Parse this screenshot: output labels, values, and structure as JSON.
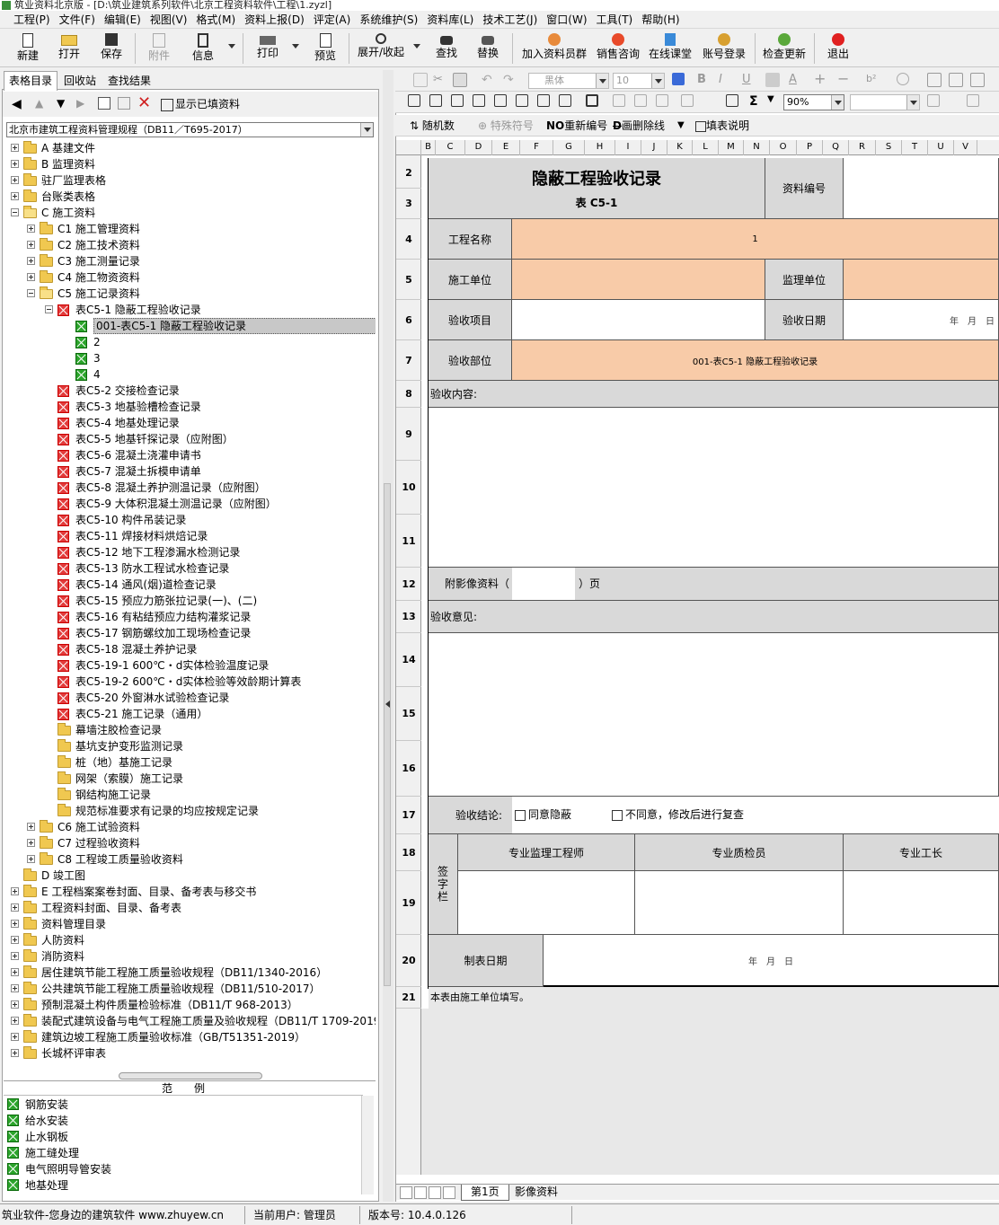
{
  "window": {
    "title": "筑业资料北京版 - [D:\\筑业建筑系列软件\\北京工程资料软件\\工程\\1.zyzl]"
  },
  "menu": [
    "工程(P)",
    "文件(F)",
    "编辑(E)",
    "视图(V)",
    "格式(M)",
    "资料上报(D)",
    "评定(A)",
    "系统维护(S)",
    "资料库(L)",
    "技术工艺(J)",
    "窗口(W)",
    "工具(T)",
    "帮助(H)"
  ],
  "toolbar": {
    "new": "新建",
    "open": "打开",
    "save": "保存",
    "attach": "附件",
    "info": "信息",
    "print": "打印",
    "preview": "预览",
    "expand": "展开/收起",
    "find": "查找",
    "replace": "替换",
    "join": "加入资料员群",
    "sales": "销售咨询",
    "online": "在线课堂",
    "login": "账号登录",
    "update": "检查更新",
    "exit": "退出"
  },
  "left_tabs": [
    "表格目录",
    "回收站",
    "查找结果"
  ],
  "left_toolbar": {
    "show_filled": "显示已填资料"
  },
  "spec_select": "北京市建筑工程资料管理规程（DB11／T695-2017）",
  "tree": [
    {
      "label": "A 基建文件",
      "level": 0,
      "exp": "plus",
      "icon": "fold"
    },
    {
      "label": "B 监理资料",
      "level": 0,
      "exp": "plus",
      "icon": "fold"
    },
    {
      "label": "驻厂监理表格",
      "level": 0,
      "exp": "plus",
      "icon": "fold"
    },
    {
      "label": "台账类表格",
      "level": 0,
      "exp": "plus",
      "icon": "fold"
    },
    {
      "label": "C 施工资料",
      "level": 0,
      "exp": "minus",
      "icon": "fold-open"
    },
    {
      "label": "C1 施工管理资料",
      "level": 1,
      "exp": "plus",
      "icon": "fold"
    },
    {
      "label": "C2 施工技术资料",
      "level": 1,
      "exp": "plus",
      "icon": "fold"
    },
    {
      "label": "C3 施工测量记录",
      "level": 1,
      "exp": "plus",
      "icon": "fold"
    },
    {
      "label": "C4 施工物资资料",
      "level": 1,
      "exp": "plus",
      "icon": "fold"
    },
    {
      "label": "C5 施工记录资料",
      "level": 1,
      "exp": "minus",
      "icon": "fold-open"
    },
    {
      "label": "表C5-1 隐蔽工程验收记录",
      "level": 2,
      "exp": "minus",
      "icon": "xr"
    },
    {
      "label": "001-表C5-1 隐蔽工程验收记录",
      "level": 3,
      "exp": "",
      "icon": "xg",
      "selected": true
    },
    {
      "label": "2",
      "level": 3,
      "exp": "",
      "icon": "xg"
    },
    {
      "label": "3",
      "level": 3,
      "exp": "",
      "icon": "xg"
    },
    {
      "label": "4",
      "level": 3,
      "exp": "",
      "icon": "xg"
    },
    {
      "label": "表C5-2 交接检查记录",
      "level": 2,
      "exp": "",
      "icon": "xr"
    },
    {
      "label": "表C5-3 地基验槽检查记录",
      "level": 2,
      "exp": "",
      "icon": "xr"
    },
    {
      "label": "表C5-4 地基处理记录",
      "level": 2,
      "exp": "",
      "icon": "xr"
    },
    {
      "label": "表C5-5 地基钎探记录（应附图）",
      "level": 2,
      "exp": "",
      "icon": "xr"
    },
    {
      "label": "表C5-6 混凝土浇灌申请书",
      "level": 2,
      "exp": "",
      "icon": "xr"
    },
    {
      "label": "表C5-7 混凝土拆模申请单",
      "level": 2,
      "exp": "",
      "icon": "xr"
    },
    {
      "label": "表C5-8 混凝土养护测温记录（应附图）",
      "level": 2,
      "exp": "",
      "icon": "xr"
    },
    {
      "label": "表C5-9 大体积混凝土测温记录（应附图）",
      "level": 2,
      "exp": "",
      "icon": "xr"
    },
    {
      "label": "表C5-10 构件吊装记录",
      "level": 2,
      "exp": "",
      "icon": "xr"
    },
    {
      "label": "表C5-11 焊接材料烘焙记录",
      "level": 2,
      "exp": "",
      "icon": "xr"
    },
    {
      "label": "表C5-12 地下工程渗漏水检测记录",
      "level": 2,
      "exp": "",
      "icon": "xr"
    },
    {
      "label": "表C5-13 防水工程试水检查记录",
      "level": 2,
      "exp": "",
      "icon": "xr"
    },
    {
      "label": "表C5-14 通风(烟)道检查记录",
      "level": 2,
      "exp": "",
      "icon": "xr"
    },
    {
      "label": "表C5-15 预应力筋张拉记录(一)、(二)",
      "level": 2,
      "exp": "",
      "icon": "xr"
    },
    {
      "label": "表C5-16 有粘结预应力结构灌浆记录",
      "level": 2,
      "exp": "",
      "icon": "xr"
    },
    {
      "label": "表C5-17 钢筋螺纹加工现场检查记录",
      "level": 2,
      "exp": "",
      "icon": "xr"
    },
    {
      "label": "表C5-18 混凝土养护记录",
      "level": 2,
      "exp": "",
      "icon": "xr"
    },
    {
      "label": "表C5-19-1 600℃・d实体检验温度记录",
      "level": 2,
      "exp": "",
      "icon": "xr"
    },
    {
      "label": "表C5-19-2 600℃・d实体检验等效龄期计算表",
      "level": 2,
      "exp": "",
      "icon": "xr"
    },
    {
      "label": "表C5-20 外窗淋水试验检查记录",
      "level": 2,
      "exp": "",
      "icon": "xr"
    },
    {
      "label": "表C5-21 施工记录（通用）",
      "level": 2,
      "exp": "",
      "icon": "xr"
    },
    {
      "label": "幕墙注胶检查记录",
      "level": 2,
      "exp": "",
      "icon": "fold"
    },
    {
      "label": "基坑支护变形监测记录",
      "level": 2,
      "exp": "",
      "icon": "fold"
    },
    {
      "label": "桩（地）基施工记录",
      "level": 2,
      "exp": "",
      "icon": "fold"
    },
    {
      "label": "网架（索膜）施工记录",
      "level": 2,
      "exp": "",
      "icon": "fold"
    },
    {
      "label": "钢结构施工记录",
      "level": 2,
      "exp": "",
      "icon": "fold"
    },
    {
      "label": "规范标准要求有记录的均应按规定记录",
      "level": 2,
      "exp": "",
      "icon": "fold"
    },
    {
      "label": "C6 施工试验资料",
      "level": 1,
      "exp": "plus",
      "icon": "fold"
    },
    {
      "label": "C7 过程验收资料",
      "level": 1,
      "exp": "plus",
      "icon": "fold"
    },
    {
      "label": "C8 工程竣工质量验收资料",
      "level": 1,
      "exp": "plus",
      "icon": "fold"
    },
    {
      "label": "D 竣工图",
      "level": 0,
      "exp": "",
      "icon": "fold"
    },
    {
      "label": "E 工程档案案卷封面、目录、备考表与移交书",
      "level": 0,
      "exp": "plus",
      "icon": "fold"
    },
    {
      "label": "工程资料封面、目录、备考表",
      "level": 0,
      "exp": "plus",
      "icon": "fold"
    },
    {
      "label": "资料管理目录",
      "level": 0,
      "exp": "plus",
      "icon": "fold"
    },
    {
      "label": "人防资料",
      "level": 0,
      "exp": "plus",
      "icon": "fold"
    },
    {
      "label": "消防资料",
      "level": 0,
      "exp": "plus",
      "icon": "fold"
    },
    {
      "label": "居住建筑节能工程施工质量验收规程（DB11/1340-2016）",
      "level": 0,
      "exp": "plus",
      "icon": "fold"
    },
    {
      "label": "公共建筑节能工程施工质量验收规程（DB11/510-2017）",
      "level": 0,
      "exp": "plus",
      "icon": "fold"
    },
    {
      "label": "预制混凝土构件质量检验标准（DB11/T 968-2013）",
      "level": 0,
      "exp": "plus",
      "icon": "fold"
    },
    {
      "label": "装配式建筑设备与电气工程施工质量及验收规程（DB11/T 1709-2019）",
      "level": 0,
      "exp": "plus",
      "icon": "fold"
    },
    {
      "label": "建筑边坡工程施工质量验收标准（GB/T51351-2019）",
      "level": 0,
      "exp": "plus",
      "icon": "fold"
    },
    {
      "label": "长城杯评审表",
      "level": 0,
      "exp": "plus",
      "icon": "fold"
    }
  ],
  "examples": {
    "header": "范　　例",
    "items": [
      "钢筋安装",
      "给水安装",
      "止水钢板",
      "施工缝处理",
      "电气照明导管安装",
      "地基处理"
    ]
  },
  "format_bar": {
    "font": "黑体",
    "size": "10",
    "zoom": "90%"
  },
  "tools_bar": {
    "random": "随机数",
    "special": "特殊符号",
    "renumber": "重新编号",
    "strike": "画删除线",
    "guide": "填表说明"
  },
  "columns": [
    "B",
    "C",
    "D",
    "E",
    "F",
    "G",
    "H",
    "I",
    "J",
    "K",
    "L",
    "M",
    "N",
    "O",
    "P",
    "Q",
    "R",
    "S",
    "T",
    "U",
    "V"
  ],
  "rows": [
    "2",
    "3",
    "4",
    "5",
    "6",
    "7",
    "8",
    "9",
    "10",
    "11",
    "12",
    "13",
    "14",
    "15",
    "16",
    "17",
    "18",
    "19",
    "20",
    "21"
  ],
  "form": {
    "title": "隐蔽工程验收记录",
    "subtitle": "表 C5-1",
    "doc_no_label": "资料编号",
    "project_name_label": "工程名称",
    "project_name_value": "1",
    "builder_label": "施工单位",
    "supervisor_label": "监理单位",
    "item_label": "验收项目",
    "date_label": "验收日期",
    "date_value": "年　月　日",
    "part_label": "验收部位",
    "part_value": "001-表C5-1 隐蔽工程验收记录",
    "content_label": "验收内容:",
    "photo_label": "附影像资料（",
    "photo_suffix": "）页",
    "opinion_label": "验收意见:",
    "conclusion_label": "验收结论:",
    "agree": "同意隐蔽",
    "disagree": "不同意，修改后进行复查",
    "sign_label": "签字栏",
    "sign_cols": [
      "专业监理工程师",
      "专业质检员",
      "专业工长"
    ],
    "made_date_label": "制表日期",
    "made_date_value": "年　月　日",
    "footer_note": "本表由施工单位填写。"
  },
  "sheet_tabs": [
    "第1页",
    "影像资料"
  ],
  "status": {
    "slogan": "筑业软件-您身边的建筑软件 www.zhuyew.cn",
    "user": "当前用户: 管理员",
    "version": "版本号: 10.4.0.126"
  }
}
